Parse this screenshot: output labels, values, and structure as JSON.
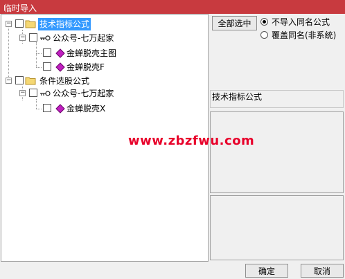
{
  "window": {
    "title": "临时导入"
  },
  "tree": {
    "nodes": [
      {
        "label": "技术指标公式",
        "type": "folder",
        "selected": true
      },
      {
        "label": "公众号-七万起家",
        "type": "author"
      },
      {
        "label": "金蝉脱壳主图",
        "type": "formula"
      },
      {
        "label": "金蝉脱壳F",
        "type": "formula"
      },
      {
        "label": "条件选股公式",
        "type": "folder"
      },
      {
        "label": "公众号-七万起家",
        "type": "author"
      },
      {
        "label": "金蝉脱壳X",
        "type": "formula"
      }
    ]
  },
  "options": {
    "select_all_label": "全部选中",
    "radio_skip_label": "不导入同名公式",
    "radio_overwrite_label": "覆盖同名(非系统)",
    "selected_radio": "skip"
  },
  "info": {
    "type_label": "技术指标公式"
  },
  "watermark": "www.zbzfwu.com",
  "footer": {
    "ok_label": "确定",
    "cancel_label": "取消"
  },
  "colors": {
    "titlebar": "#c83a3f",
    "selection": "#3399ff",
    "watermark": "#e8002a"
  }
}
